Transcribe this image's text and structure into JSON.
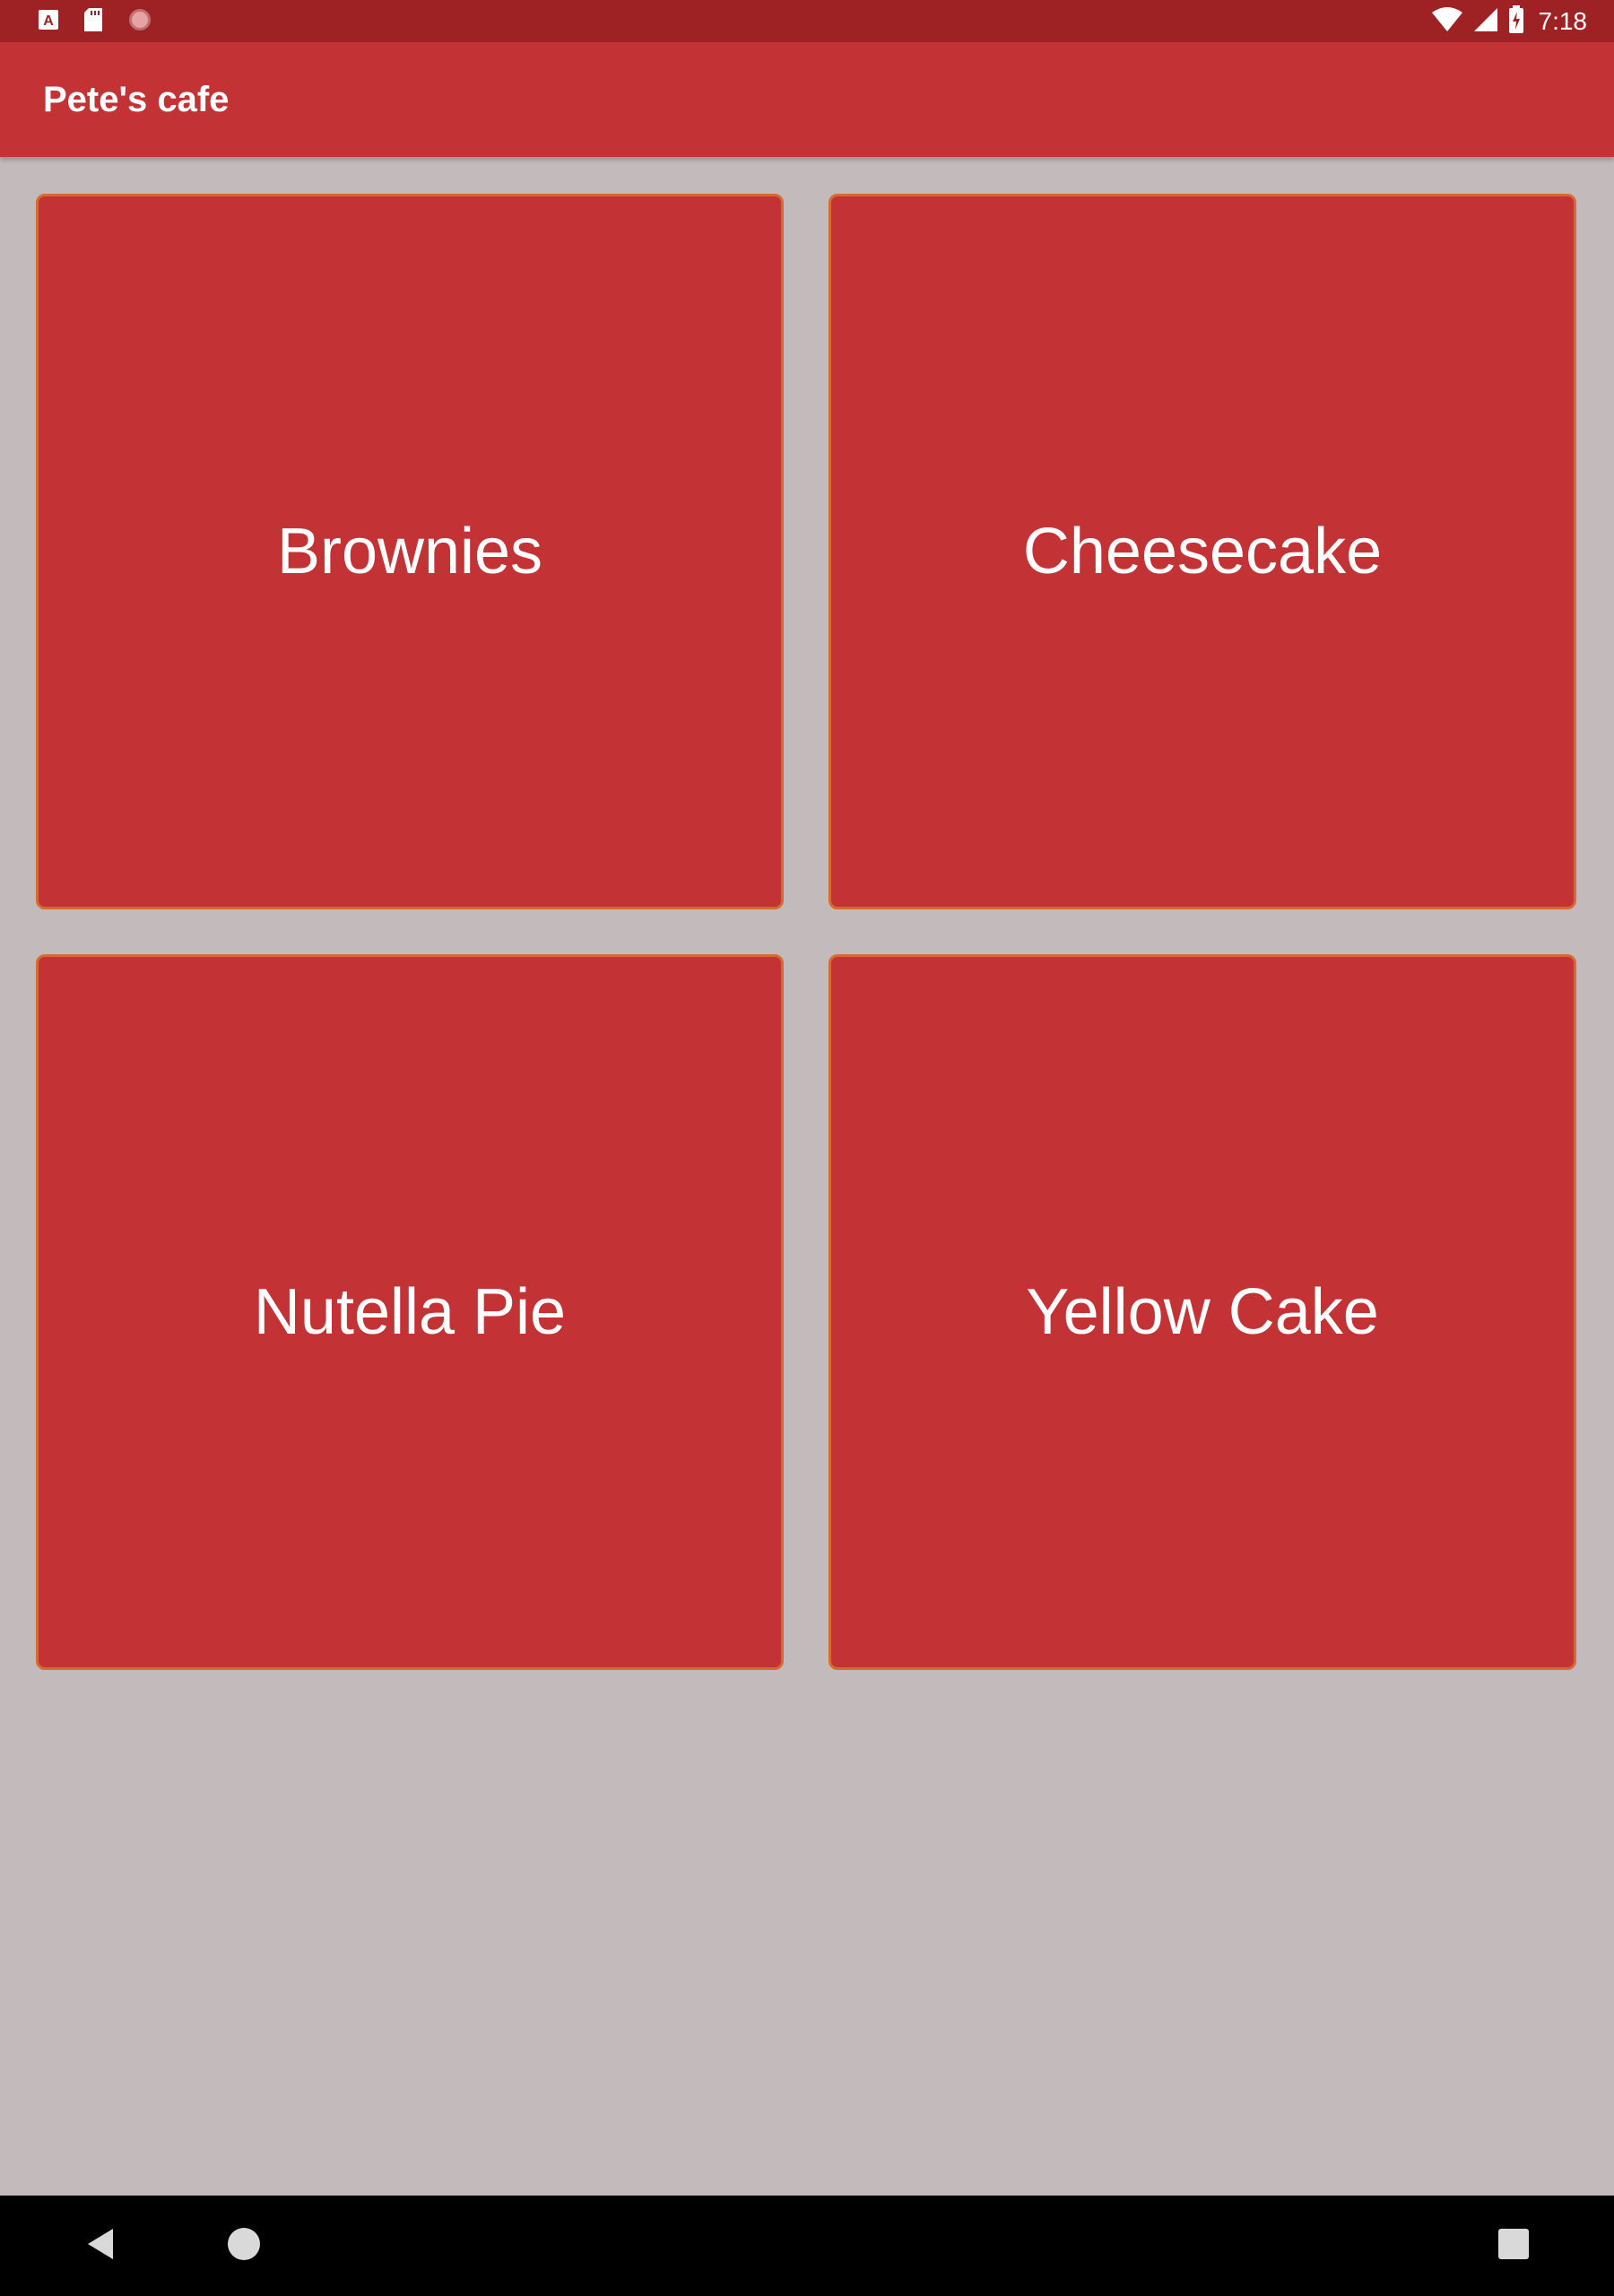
{
  "status_bar": {
    "time": "7:18",
    "left_icons": [
      "a-keyboard-icon",
      "sd-card-icon",
      "record-dot-icon"
    ],
    "right_icons": [
      "wifi-icon",
      "cell-signal-icon",
      "battery-charging-icon"
    ]
  },
  "app_bar": {
    "title": "Pete's cafe",
    "background": "#c33335"
  },
  "menu": {
    "items": [
      {
        "label": "Brownies"
      },
      {
        "label": "Cheesecake"
      },
      {
        "label": "Nutella Pie"
      },
      {
        "label": "Yellow Cake"
      }
    ]
  },
  "colors": {
    "status_bar": "#9e2224",
    "app_bar": "#c33335",
    "tile": "#c33335",
    "tile_border": "#d76a2e",
    "background": "#c3bbbb",
    "nav_bar": "#000000"
  },
  "nav_bar": {
    "icons": [
      "back-icon",
      "home-icon",
      "recents-icon"
    ]
  }
}
